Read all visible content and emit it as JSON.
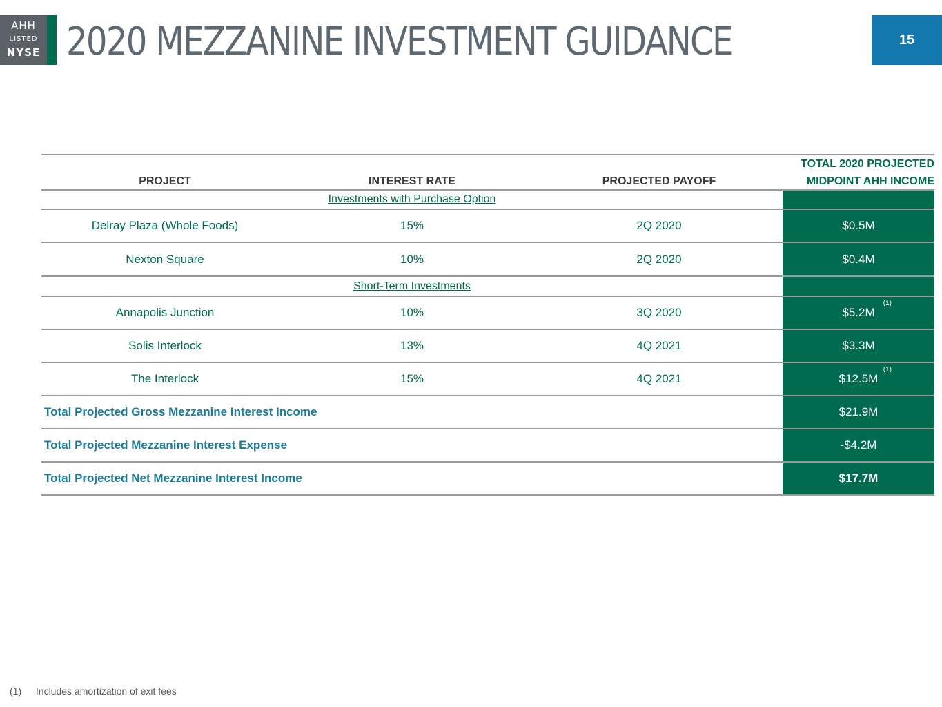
{
  "logo": {
    "line1": "AHH",
    "line2": "LISTED",
    "line3": "NYSE"
  },
  "title": "2020 MEZZANINE INVESTMENT GUIDANCE",
  "page_number": "15",
  "colors": {
    "green": "#006b4f",
    "blue": "#1479ad",
    "gray": "#5b6166",
    "total_text": "#1a7a9a"
  },
  "table": {
    "headers": {
      "project": "PROJECT",
      "rate": "INTEREST RATE",
      "payoff": "PROJECTED PAYOFF",
      "income_line1": "TOTAL 2020 PROJECTED",
      "income_line2": "MIDPOINT AHH INCOME"
    },
    "section1": "Investments with Purchase Option",
    "section1_rows": [
      {
        "project": "Delray Plaza (Whole Foods)",
        "rate": "15%",
        "payoff": "2Q 2020",
        "income": "$0.5M",
        "note": ""
      },
      {
        "project": "Nexton Square",
        "rate": "10%",
        "payoff": "2Q 2020",
        "income": "$0.4M",
        "note": ""
      }
    ],
    "section2": "Short-Term Investments",
    "section2_rows": [
      {
        "project": "Annapolis Junction",
        "rate": "10%",
        "payoff": "3Q 2020",
        "income": "$5.2M",
        "note": "(1)"
      },
      {
        "project": "Solis Interlock",
        "rate": "13%",
        "payoff": "4Q 2021",
        "income": "$3.3M",
        "note": ""
      },
      {
        "project": "The Interlock",
        "rate": "15%",
        "payoff": "4Q 2021",
        "income": "$12.5M",
        "note": "(1)"
      }
    ],
    "totals": [
      {
        "label": "Total Projected Gross Mezzanine Interest Income",
        "value": "$21.9M"
      },
      {
        "label": "Total Projected Mezzanine Interest Expense",
        "value": "-$4.2M"
      },
      {
        "label": "Total Projected Net Mezzanine Interest Income",
        "value": "$17.7M"
      }
    ]
  },
  "footnote": {
    "number": "(1)",
    "text": "Includes amortization of exit fees"
  }
}
